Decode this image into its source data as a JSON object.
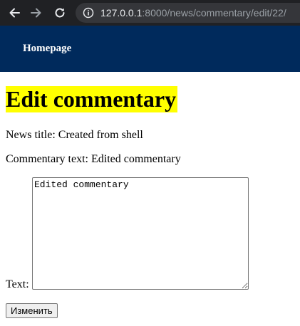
{
  "browser": {
    "url_host": "127.0.0.1",
    "url_rest": ":8000/news/commentary/edit/22/",
    "icons": [
      "back-arrow-icon",
      "forward-arrow-icon",
      "reload-icon",
      "info-icon"
    ]
  },
  "header": {
    "home_label": "Homepage",
    "background": "#002a5c"
  },
  "page": {
    "title": "Edit commentary",
    "title_highlight": "#ffff00",
    "news_title_line": "News title: Created from shell",
    "commentary_line": "Commentary text: Edited commentary"
  },
  "form": {
    "text_label": "Text:",
    "text_value": "Edited commentary",
    "submit_label": "Изменить"
  }
}
